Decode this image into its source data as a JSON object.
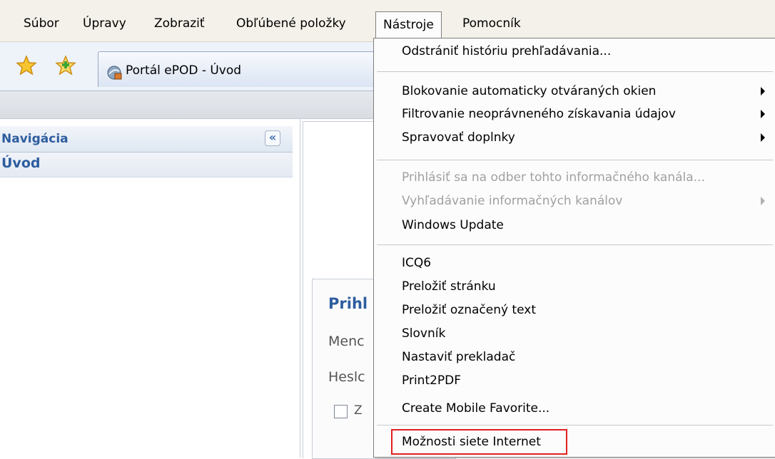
{
  "menubar": {
    "items": [
      "Súbor",
      "Úpravy",
      "Zobraziť",
      "Obľúbené položky",
      "Nástroje",
      "Pomocník"
    ],
    "active": "Nástroje"
  },
  "toolbar": {
    "favorites_icon": "favorites-star-icon",
    "add_favorite_icon": "add-favorite-icon",
    "tab_title": "Portál ePOD - Úvod"
  },
  "navigation": {
    "title": "Navigácia",
    "collapse_label": "«",
    "items": [
      "Úvod"
    ]
  },
  "login": {
    "title": "Prihl",
    "username_label": "Menc",
    "password_label": "Heslc",
    "remember_label": "Z"
  },
  "tools_menu": {
    "items": [
      {
        "label": "Odstrániť históriu prehľadávania...",
        "disabled": false,
        "submenu": false
      },
      {
        "label": "Blokovanie automaticky otváraných okien",
        "disabled": false,
        "submenu": true
      },
      {
        "label": "Filtrovanie neoprávneného získavania údajov",
        "disabled": false,
        "submenu": true
      },
      {
        "label": "Spravovať doplnky",
        "disabled": false,
        "submenu": true
      },
      {
        "label": "Prihlásiť sa na odber tohto informačného kanála...",
        "disabled": true,
        "submenu": false
      },
      {
        "label": "Vyhľadávanie informačných kanálov",
        "disabled": true,
        "submenu": true
      },
      {
        "label": "Windows Update",
        "disabled": false,
        "submenu": false
      },
      {
        "label": "ICQ6",
        "disabled": false,
        "submenu": false
      },
      {
        "label": "Preložiť stránku",
        "disabled": false,
        "submenu": false
      },
      {
        "label": "Preložiť označený text",
        "disabled": false,
        "submenu": false
      },
      {
        "label": "Slovník",
        "disabled": false,
        "submenu": false
      },
      {
        "label": "Nastaviť prekladač",
        "disabled": false,
        "submenu": false
      },
      {
        "label": "Print2PDF",
        "disabled": false,
        "submenu": false
      },
      {
        "label": "Create Mobile Favorite...",
        "disabled": false,
        "submenu": false
      },
      {
        "label": "Možnosti siete Internet",
        "disabled": false,
        "submenu": false,
        "highlighted": true
      }
    ],
    "highlight_color": "#e02020"
  },
  "colors": {
    "accent": "#2d5d9f",
    "menubar_bg": "#f3f1e9",
    "disabled_text": "#a0a0a0"
  }
}
